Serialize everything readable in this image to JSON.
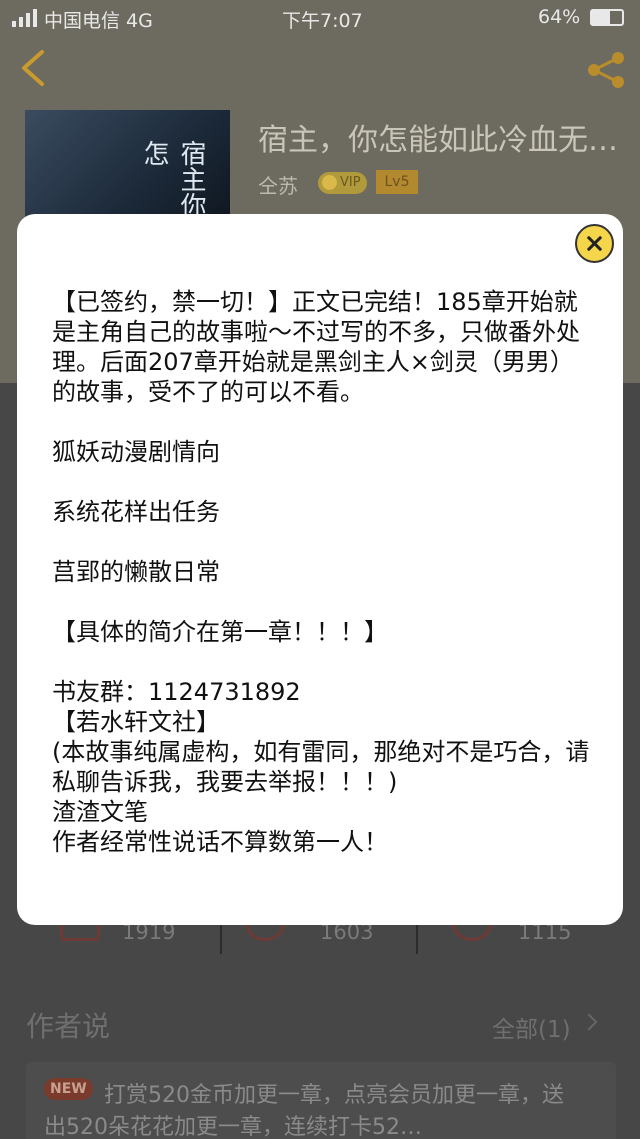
{
  "status_bar": {
    "carrier": "中国电信  4G",
    "time": "下午7:07",
    "battery": "64%"
  },
  "book": {
    "cover_text": "宿主你怎",
    "title": "宿主，你怎能如此冷血无…",
    "author": "仝苏",
    "vip_badge": "VIP",
    "level_badge": "Lv5"
  },
  "stats": [
    {
      "value": "1919"
    },
    {
      "value": "1603"
    },
    {
      "value": "1115"
    }
  ],
  "author_says": {
    "title": "作者说",
    "all_label": "全部(1)",
    "new_badge": "NEW",
    "note": "打赏520金币加更一章，点亮会员加更一章，送出520朵花花加更一章，连续打卡52…"
  },
  "modal": {
    "paragraph1": "【已签约，禁一切！】正文已完结！185章开始就是主角自己的故事啦～不过写的不多，只做番外处理。后面207章开始就是黑剑主人×剑灵（男男）的故事，受不了的可以不看。",
    "line_fox": "狐妖动漫剧情向",
    "line_system": "系统花样出任务",
    "line_daily": "莒郢的懒散日常",
    "line_detail": "【具体的简介在第一章！！！】",
    "line_group": "书友群：1124731892",
    "line_club": "【若水轩文社】",
    "line_fiction": "(本故事纯属虚构，如有雷同，那绝对不是巧合，请私聊告诉我，我要去举报！！！)",
    "line_writer": "渣渣文笔",
    "line_promise": "作者经常性说话不算数第一人！"
  },
  "colors": {
    "accent": "#f5d54a",
    "overlay_bg": "#474747",
    "modal_bg": "#ffffff"
  }
}
